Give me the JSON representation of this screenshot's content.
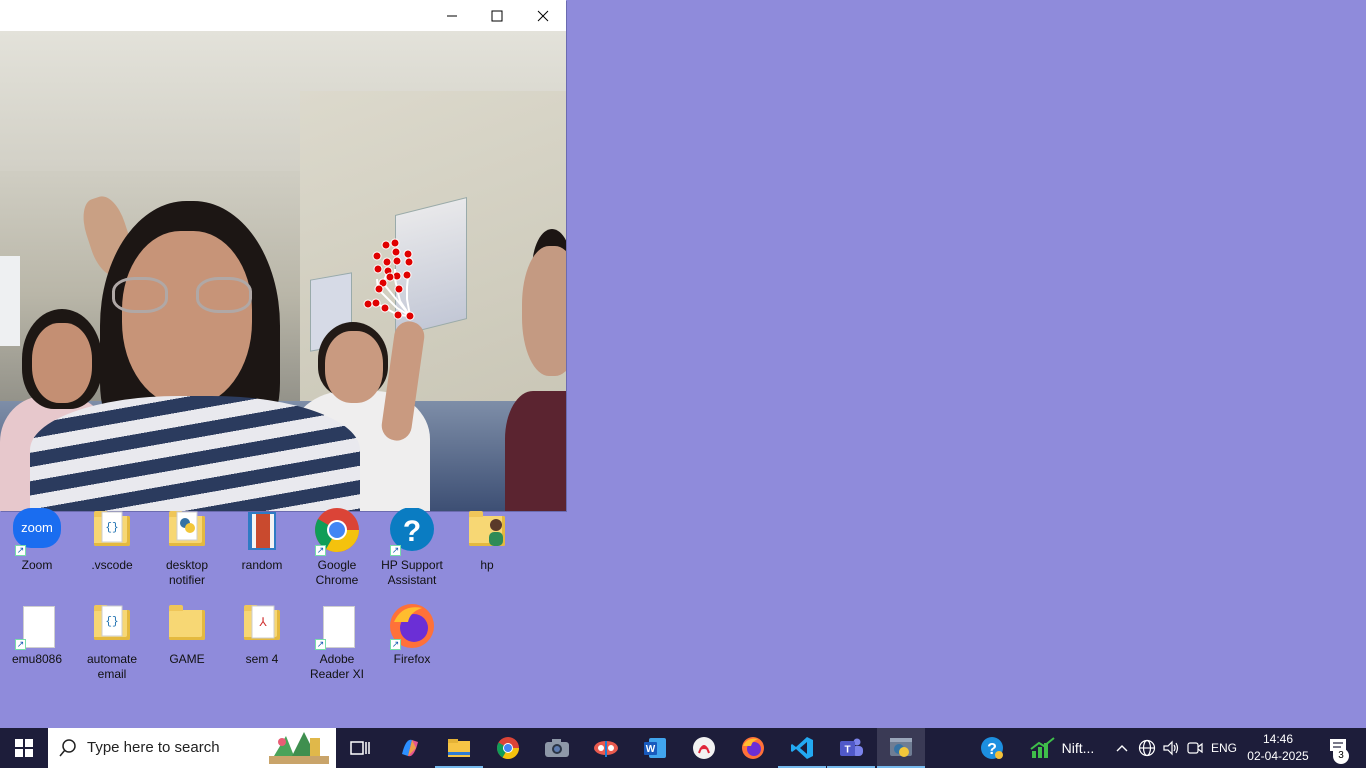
{
  "camera_window": {
    "controls": [
      "minimize",
      "maximize",
      "close"
    ]
  },
  "desktop_icons": [
    {
      "label": "Zoom",
      "icon": "zoom-icon",
      "shortcut": true
    },
    {
      "label": ".vscode",
      "icon": "folder-icon",
      "shortcut": false
    },
    {
      "label": "desktop notifier",
      "icon": "python-folder-icon",
      "shortcut": false
    },
    {
      "label": "random",
      "icon": "book-icon",
      "shortcut": false
    },
    {
      "label": "Google Chrome",
      "icon": "chrome-icon",
      "shortcut": true
    },
    {
      "label": "HP Support Assistant",
      "icon": "hp-support-icon",
      "shortcut": true
    },
    {
      "label": "hp",
      "icon": "user-folder-icon",
      "shortcut": false
    },
    {
      "label": "emu8086",
      "icon": "blank-file-icon",
      "shortcut": true
    },
    {
      "label": "automate email",
      "icon": "folder-icon",
      "shortcut": false
    },
    {
      "label": "GAME",
      "icon": "folder-icon",
      "shortcut": false
    },
    {
      "label": "sem 4",
      "icon": "pdf-icon",
      "shortcut": false
    },
    {
      "label": "Adobe Reader XI",
      "icon": "blank-file-icon",
      "shortcut": true
    },
    {
      "label": "Firefox",
      "icon": "firefox-icon",
      "shortcut": true
    }
  ],
  "taskbar": {
    "search_placeholder": "Type here to search",
    "apps": [
      "task-view",
      "copilot",
      "file-explorer",
      "chrome",
      "camera",
      "snipping-tool",
      "word",
      "acrobat",
      "firefox",
      "vscode",
      "teams",
      "python"
    ],
    "tray": {
      "nifty_label": "Nift...",
      "language": "ENG",
      "time": "14:46",
      "date": "02-04-2025",
      "notification_count": "3"
    }
  },
  "colors": {
    "desktop": "#8f8bdb",
    "taskbar": "#1d1d3a",
    "landmark": "#e00000"
  }
}
